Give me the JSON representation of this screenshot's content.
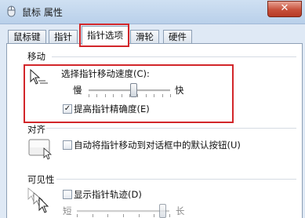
{
  "window": {
    "title": "鼠标 属性",
    "close_glyph": "✕"
  },
  "tabs": [
    {
      "label": "鼠标键"
    },
    {
      "label": "指针"
    },
    {
      "label": "指针选项"
    },
    {
      "label": "滑轮"
    },
    {
      "label": "硬件"
    }
  ],
  "motion": {
    "group_label": "移动",
    "speed_label": "选择指针移动速度(C):",
    "slow": "慢",
    "fast": "快",
    "speed_level": 0.55,
    "precision_label": "提高指针精确度(E)",
    "precision_checked": true,
    "check_glyph": "✓"
  },
  "snap": {
    "group_label": "对齐",
    "checkbox_label": "自动将指针移动到对话框中的默认按钮(U)",
    "checked": false
  },
  "visibility": {
    "group_label": "可见性",
    "trails_label": "显示指针轨迹(D)",
    "trails_checked": false,
    "short": "短",
    "long": "长",
    "trail_level": 0.92
  },
  "colors": {
    "highlight": "#d2262a"
  }
}
